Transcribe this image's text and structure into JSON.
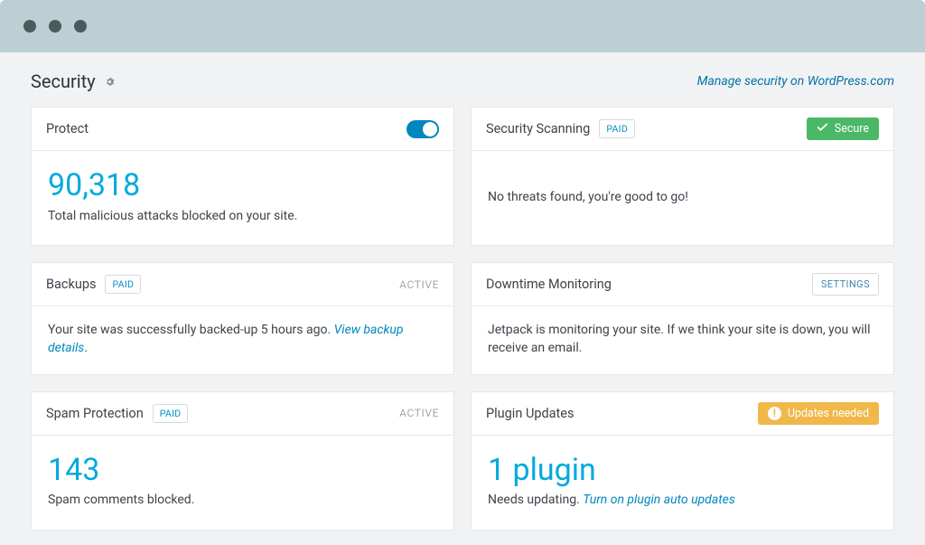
{
  "header": {
    "title": "Security",
    "manage_link": "Manage security on WordPress.com"
  },
  "cards": {
    "protect": {
      "title": "Protect",
      "count": "90,318",
      "caption": "Total malicious attacks blocked on your site."
    },
    "scanning": {
      "title": "Security Scanning",
      "paid": "PAID",
      "badge": "Secure",
      "body": "No threats found, you're good to go!"
    },
    "backups": {
      "title": "Backups",
      "paid": "PAID",
      "status": "ACTIVE",
      "body": "Your site was successfully backed-up 5 hours ago. ",
      "link": "View backup details",
      "period": "."
    },
    "downtime": {
      "title": "Downtime Monitoring",
      "settings": "SETTINGS",
      "body": "Jetpack is monitoring your site. If we think your site is down, you will receive an email."
    },
    "spam": {
      "title": "Spam Protection",
      "paid": "PAID",
      "status": "ACTIVE",
      "count": "143",
      "caption": "Spam comments blocked."
    },
    "plugins": {
      "title": "Plugin Updates",
      "badge": "Updates needed",
      "count": "1 plugin",
      "caption": "Needs updating. ",
      "link": "Turn on plugin auto updates"
    }
  }
}
